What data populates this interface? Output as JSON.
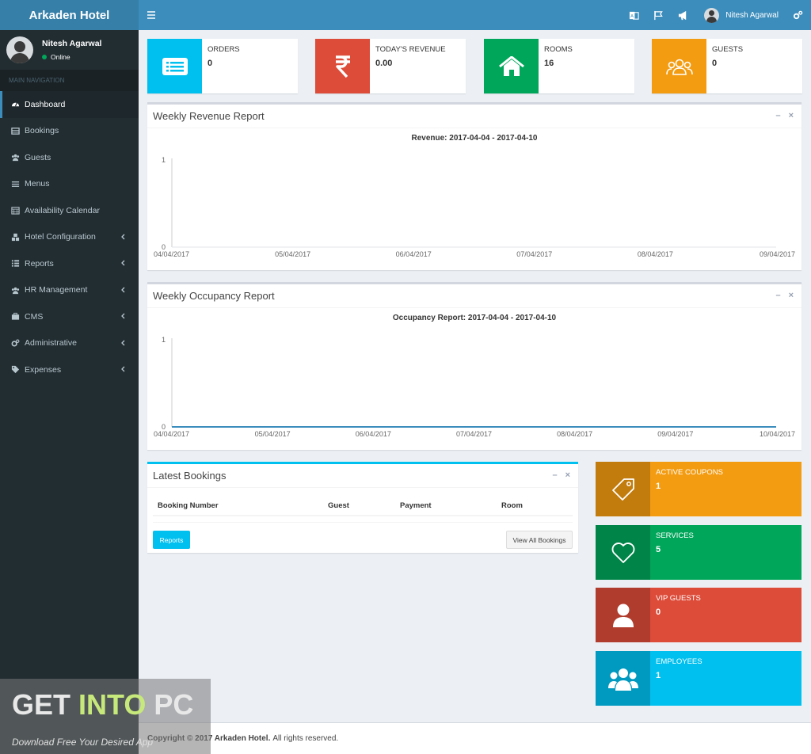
{
  "app": {
    "brand": "Arkaden Hotel"
  },
  "user": {
    "name": "Nitesh Agarwal",
    "status": "Online"
  },
  "sidebar": {
    "header": "MAIN NAVIGATION",
    "items": [
      {
        "label": "Dashboard",
        "icon": "dashboard-icon"
      },
      {
        "label": "Bookings",
        "icon": "table-icon"
      },
      {
        "label": "Guests",
        "icon": "users-icon"
      },
      {
        "label": "Menus",
        "icon": "list-icon"
      },
      {
        "label": "Availability Calendar",
        "icon": "calendar-icon"
      },
      {
        "label": "Hotel Configuration",
        "icon": "cubes-icon"
      },
      {
        "label": "Reports",
        "icon": "th-list-icon"
      },
      {
        "label": "HR Management",
        "icon": "users-icon"
      },
      {
        "label": "CMS",
        "icon": "briefcase-icon"
      },
      {
        "label": "Administrative",
        "icon": "cogs-icon"
      },
      {
        "label": "Expenses",
        "icon": "tags-icon"
      }
    ]
  },
  "topbar": {
    "user_name": "Nitesh Agarwal"
  },
  "info_boxes": [
    {
      "label": "ORDERS",
      "value": "0",
      "color": "#00c0ef",
      "icon": "list-alt-icon"
    },
    {
      "label": "TODAY'S REVENUE",
      "value": "0.00",
      "color": "#dd4b39",
      "icon": "rupee-icon"
    },
    {
      "label": "ROOMS",
      "value": "16",
      "color": "#00a65a",
      "icon": "home-icon"
    },
    {
      "label": "GUESTS",
      "value": "0",
      "color": "#f39c12",
      "icon": "group-icon"
    }
  ],
  "revenue_panel": {
    "title": "Weekly Revenue Report"
  },
  "occupancy_panel": {
    "title": "Weekly Occupancy Report"
  },
  "chart_data": [
    {
      "type": "line",
      "title": "Revenue: 2017-04-04 - 2017-04-10",
      "x": [
        "04/04/2017",
        "05/04/2017",
        "06/04/2017",
        "07/04/2017",
        "08/04/2017",
        "09/04/2017"
      ],
      "y_ticks": [
        "1",
        "0"
      ],
      "ylim": [
        0,
        1
      ],
      "series": [
        {
          "values": [
            0,
            0,
            0,
            0,
            0,
            0
          ]
        }
      ]
    },
    {
      "type": "line",
      "title": "Occupancy Report: 2017-04-04 - 2017-04-10",
      "x": [
        "04/04/2017",
        "05/04/2017",
        "06/04/2017",
        "07/04/2017",
        "08/04/2017",
        "09/04/2017",
        "10/04/2017"
      ],
      "y_ticks": [
        "1",
        "0"
      ],
      "ylim": [
        0,
        1
      ],
      "series": [
        {
          "values": [
            0,
            0,
            0,
            0,
            0,
            0,
            0
          ],
          "color": "#3c8dbc"
        }
      ]
    }
  ],
  "bookings": {
    "title": "Latest Bookings",
    "columns": [
      "Booking Number",
      "Guest",
      "Payment",
      "Room"
    ],
    "reports_button": "Reports",
    "view_all_button": "View All Bookings"
  },
  "color_boxes": [
    {
      "label": "ACTIVE COUPONS",
      "value": "1",
      "color": "#f39c12",
      "icon": "tag-icon"
    },
    {
      "label": "SERVICES",
      "value": "5",
      "color": "#00a65a",
      "icon": "heart-icon"
    },
    {
      "label": "VIP GUESTS",
      "value": "0",
      "color": "#dd4b39",
      "icon": "user-icon"
    },
    {
      "label": "EMPLOYEES",
      "value": "1",
      "color": "#00c0ef",
      "icon": "group-icon"
    }
  ],
  "footer": {
    "copyright": "Copyright © 2017 Arkaden Hotel.",
    "rights": "All rights reserved."
  },
  "watermark": {
    "brand_a": "GET ",
    "brand_b": "INTO",
    "brand_c": " PC",
    "tagline": "Download Free Your Desired App"
  }
}
